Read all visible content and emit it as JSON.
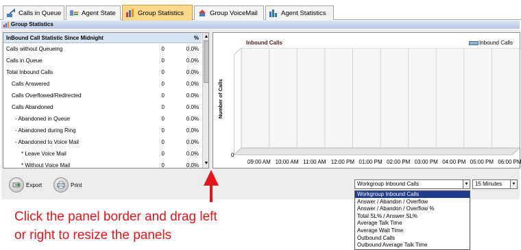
{
  "tabs": [
    {
      "label": "Calls in Queue",
      "icon": "calls-in-queue-icon",
      "active": false
    },
    {
      "label": "Agent State",
      "icon": "agent-state-icon",
      "active": false
    },
    {
      "label": "Group Statistics",
      "icon": "group-statistics-icon",
      "active": true
    },
    {
      "label": "Group VoiceMail",
      "icon": "group-voicemail-icon",
      "active": false
    },
    {
      "label": "Agent Statistics",
      "icon": "agent-statistics-icon",
      "active": false
    }
  ],
  "panel_title": "Group Statistics",
  "table": {
    "header": {
      "label": "InBound Call Statistic Since Midnight",
      "count": "",
      "percent": "%"
    },
    "rows": [
      {
        "label": "Calls without Queueing",
        "count": "0",
        "percent": "0.0%"
      },
      {
        "label": "Calls in Queue",
        "count": "0",
        "percent": "0.0%"
      },
      {
        "label": "Total Inbound Calls",
        "count": "0",
        "percent": "0.0%"
      },
      {
        "label": "Calls Answered",
        "count": "0",
        "percent": "0.0%"
      },
      {
        "label": "Calls Overflowed/Redirected",
        "count": "0",
        "percent": "0.0%"
      },
      {
        "label": "Calls Abandoned",
        "count": "0",
        "percent": "0.0%"
      },
      {
        "label": "- Abandoned in Queue",
        "count": "0",
        "percent": "0.0%"
      },
      {
        "label": "- Abandoned during Ring",
        "count": "0",
        "percent": "0.0%"
      },
      {
        "label": "- Abandoned to Voice Mail",
        "count": "0",
        "percent": "0.0%"
      },
      {
        "label": "* Leave Voice Mail",
        "count": "0",
        "percent": "0.0%"
      },
      {
        "label": "* Without Voice Mail",
        "count": "0",
        "percent": "0.0%"
      }
    ]
  },
  "chart": {
    "title": "Inbound Calls",
    "legend": "Inbound Calls",
    "ylabel": "Number of Calls",
    "y_zero": "0",
    "x_ticks": [
      "09:00 AM",
      "10:00 AM",
      "11:00 AM",
      "12:00 PM",
      "01:00 PM",
      "02:00 PM",
      "03:00 PM",
      "04:00 PM",
      "05:00 PM",
      "06:00 PM"
    ]
  },
  "buttons": {
    "export": "Export",
    "print": "Print"
  },
  "chart_select": {
    "value": "Workgroup Inbound Calls",
    "options": [
      "Workgroup Inbound Calls",
      "Answer / Abandon / Overflow",
      "Answer / Abandon / Overflow %",
      "Total SL% / Answer SL%",
      "Average Talk Time",
      "Average Wait Time",
      "Outbound Calls",
      "Outbound Average Talk Time"
    ]
  },
  "interval_select": {
    "value": "15 Minutes"
  },
  "annotation": {
    "line1": "Click the panel border and drag left",
    "line2": "or right to resize the panels"
  },
  "colors": {
    "active_tab": "#fcd88a",
    "selected_option": "#1f3d8d",
    "annotation": "#e8141a",
    "legend_swatch": "#8fb1d6"
  }
}
